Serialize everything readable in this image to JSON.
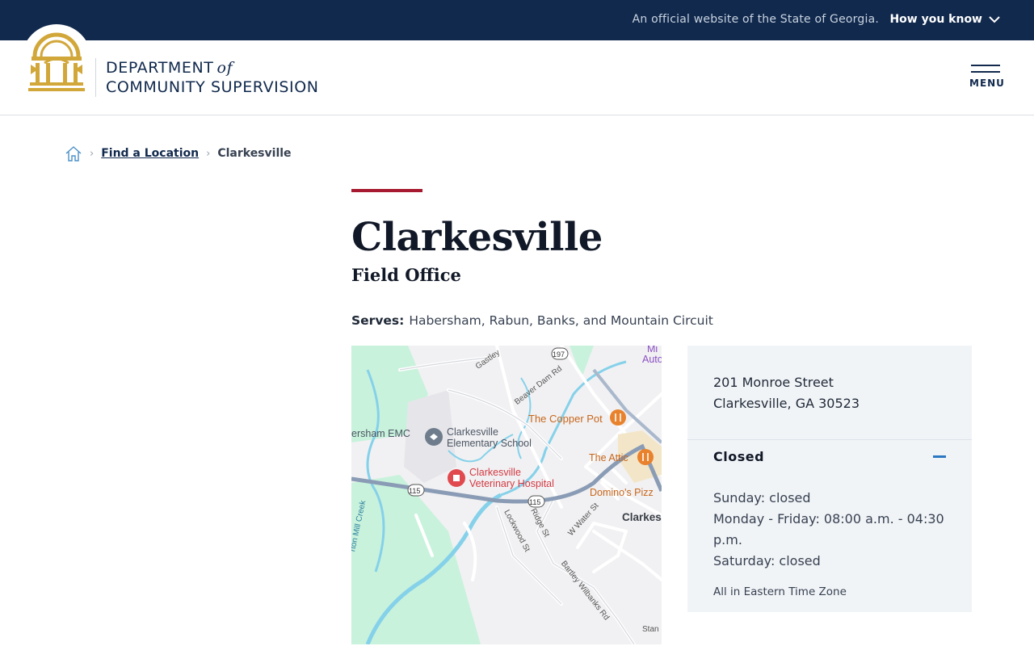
{
  "gov_banner": {
    "official_text": "An official website of the State of Georgia.",
    "how_you_know": "How you know"
  },
  "header": {
    "department_line1": "DEPARTMENT",
    "department_of": "of",
    "department_line2": "COMMUNITY SUPERVISION",
    "menu_label": "MENU"
  },
  "breadcrumb": {
    "items": [
      "Find a Location",
      "Clarkesville"
    ]
  },
  "page": {
    "title": "Clarkesville",
    "subtitle": "Field Office",
    "serves_label": "Serves:",
    "serves_value": "Habersham, Rabun, Banks, and Mountain Circuit"
  },
  "map": {
    "labels": {
      "copper_pot": "The Copper Pot",
      "school_1": "Clarkesville",
      "school_2": "Elementary School",
      "emc": "ersham EMC",
      "vet_1": "Clarkesville",
      "vet_2": "Veterinary Hospital",
      "attic": "The Attic",
      "dominos": "Domino's Pizz",
      "town": "Clarkes",
      "gastley": "Gastley",
      "beaver_dam": "Beaver Dam Rd",
      "lockwood": "Lockwood St",
      "ridge": "Ridge St",
      "w_water": "W Water St",
      "bartley": "Bartley Wilbanks Rd",
      "mill_creek": "rton Mill Creek",
      "auto_1": "Mi",
      "auto_2": "Auto",
      "stan": "Stan",
      "route_197": "197",
      "route_115a": "115",
      "route_115b": "115"
    },
    "colors": {
      "water": "#85d1ea",
      "park": "#c9f2dc",
      "road": "#ffffff",
      "highway": "#8a9cb5",
      "food": "#e8822d",
      "medical": "#e04a4f",
      "school_icon": "#6e7c8c"
    }
  },
  "location": {
    "address_line1": "201 Monroe Street",
    "address_line2": "Clarkesville, GA 30523",
    "status": "Closed",
    "hours": [
      "Sunday: closed",
      "Monday - Friday: 08:00 a.m. - 04:30 p.m.",
      "Saturday: closed"
    ],
    "timezone_note": "All in Eastern Time Zone"
  }
}
